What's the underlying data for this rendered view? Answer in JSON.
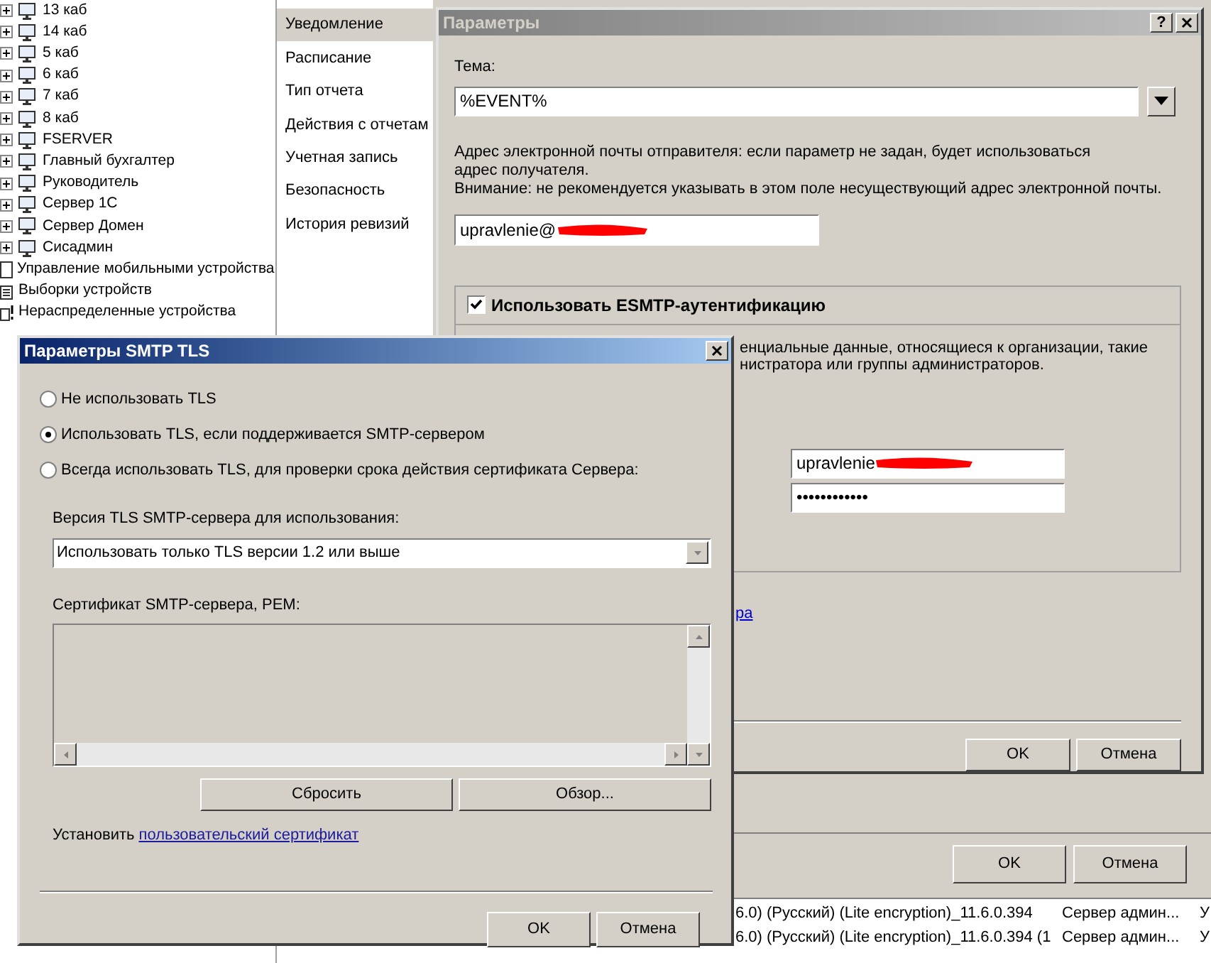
{
  "device_tree": {
    "items": [
      {
        "label": "13 каб",
        "kind": "group",
        "expanded": false
      },
      {
        "label": "14 каб",
        "kind": "group",
        "expanded": false
      },
      {
        "label": "5 каб",
        "kind": "group",
        "expanded": false
      },
      {
        "label": "6 каб",
        "kind": "group",
        "expanded": false
      },
      {
        "label": "7 каб",
        "kind": "group",
        "expanded": false
      },
      {
        "label": "8 каб",
        "kind": "group",
        "expanded": false
      },
      {
        "label": "FSERVER",
        "kind": "group",
        "expanded": false
      },
      {
        "label": "Главный бухгалтер",
        "kind": "group",
        "expanded": false
      },
      {
        "label": "Руководитель",
        "kind": "group",
        "expanded": false
      },
      {
        "label": "Сервер 1С",
        "kind": "group",
        "expanded": false
      },
      {
        "label": "Сервер Домен",
        "kind": "group",
        "expanded": false
      },
      {
        "label": "Сисадмин",
        "kind": "group",
        "expanded": false
      },
      {
        "label": "Управление мобильными устройства",
        "kind": "mobile"
      },
      {
        "label": "Выборки устройств",
        "kind": "selection"
      },
      {
        "label": "Нераспределенные устройства",
        "kind": "unassigned"
      }
    ]
  },
  "settings_nav": [
    {
      "label": "Уведомление",
      "selected": true
    },
    {
      "label": "Расписание",
      "selected": false
    },
    {
      "label": "Тип отчета",
      "selected": false
    },
    {
      "label": "Действия с отчетам",
      "selected": false
    },
    {
      "label": "Учетная запись",
      "selected": false
    },
    {
      "label": "Безопасность",
      "selected": false
    },
    {
      "label": "История ревизий",
      "selected": false
    }
  ],
  "parameters_dialog": {
    "title": "Параметры",
    "help": "?",
    "subject_label": "Тема:",
    "subject_value": "%EVENT%",
    "sender_hint": "Адрес электронной почты отправителя: если параметр не задан, будет использоваться адрес получателя.",
    "sender_warning": "Внимание: не рекомендуется указывать в этом поле несуществующий адрес электронной почты.",
    "sender_value": "upravlenie@",
    "esmtp": {
      "label": "Использовать ESMTP-аутентификацию",
      "checked": true,
      "description": [
        "енциальные данные, относящиеся к организации, такие",
        "нистратора или группы администраторов."
      ],
      "login_value": "upravlenie",
      "password_value": "••••••••••••"
    },
    "link_fragment": "ра",
    "buttons": [
      "OK",
      "Отмена"
    ]
  },
  "tls_dialog": {
    "title": "Параметры SMTP TLS",
    "options": [
      {
        "label": "Не использовать TLS",
        "selected": false
      },
      {
        "label": "Использовать TLS, если поддерживается SMTP-сервером",
        "selected": true
      },
      {
        "label": "Всегда использовать TLS, для проверки срока действия сертификата Сервера:",
        "selected": false
      }
    ],
    "version_label": "Версия TLS SMTP-сервера для использования:",
    "version_value": "Использовать только TLS версии 1.2 или выше",
    "certificate_label": "Сертификат SMTP-сервера, PEM:",
    "certificate_buttons": [
      "Сбросить",
      "Обзор..."
    ],
    "install_text": "Установить",
    "install_link": "пользовательский сертификат",
    "buttons": [
      "OK",
      "Отмена"
    ]
  },
  "outer_buttons": [
    "OK",
    "Отмена"
  ],
  "results_list": {
    "rows": [
      {
        "column_1": "6.0) (Русский) (Lite encryption)_11.6.0.394",
        "column_2": "Сервер админ...",
        "column_3": "У"
      },
      {
        "column_1": "6.0) (Русский) (Lite encryption)_11.6.0.394 (1",
        "column_2": "Сервер админ...",
        "column_3": "У"
      }
    ]
  }
}
